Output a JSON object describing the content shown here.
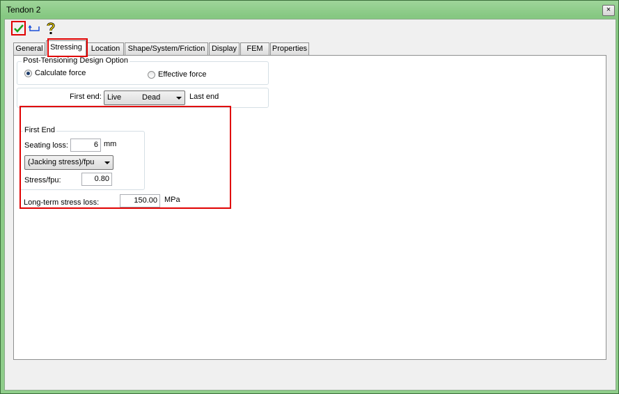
{
  "window": {
    "title": "Tendon 2",
    "close_glyph": "×"
  },
  "toolbar": {
    "ok_icon": "checkmark-icon",
    "reset_icon": "reset-icon",
    "help_icon": "help-icon"
  },
  "tabs": [
    {
      "label": "General"
    },
    {
      "label": "Stressing"
    },
    {
      "label": "Location"
    },
    {
      "label": "Shape/System/Friction"
    },
    {
      "label": "Display"
    },
    {
      "label": "FEM"
    },
    {
      "label": "Properties"
    }
  ],
  "post_tensioning": {
    "legend": "Post-Tensioning Design Option",
    "calculate_force": "Calculate force",
    "effective_force": "Effective force"
  },
  "ends": {
    "first_end_label": "First end:",
    "first_end_value_a": "Live",
    "first_end_value_b": "Dead",
    "last_end_label": "Last end"
  },
  "first_end_group": {
    "legend": "First End",
    "seating_loss_label": "Seating loss:",
    "seating_loss_value": "6",
    "seating_loss_unit": "mm",
    "stress_type_value": "(Jacking stress)/fpu",
    "stress_fpu_label": "Stress/fpu:",
    "stress_fpu_value": "0.80"
  },
  "long_term": {
    "label": "Long-term stress loss:",
    "value": "150.00",
    "unit": "MPa"
  },
  "colors": {
    "highlight": "#e00000",
    "title_bar": "#86c882"
  }
}
